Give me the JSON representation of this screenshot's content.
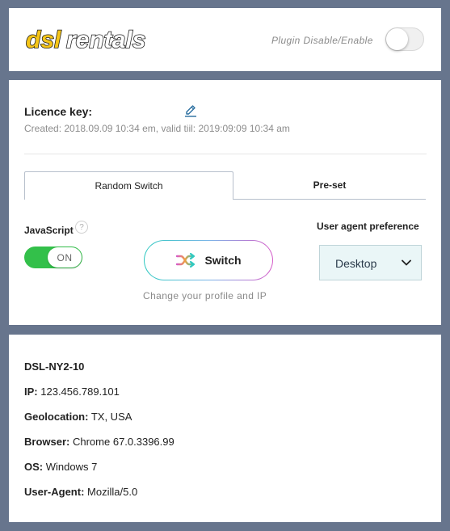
{
  "header": {
    "logo_text": "dslrentals",
    "plugin_label": "Plugin Disable/Enable",
    "plugin_enabled": false
  },
  "licence": {
    "title": "Licence key:",
    "meta": "Created: 2018.09.09 10:34 em, valid tiil: 2019:09:09 10:34 am"
  },
  "tabs": [
    {
      "label": "Random Switch",
      "active": true
    },
    {
      "label": "Pre-set",
      "active": false
    }
  ],
  "javascript": {
    "label": "JavaScript",
    "help": "?",
    "toggle_state": "ON"
  },
  "switch": {
    "label": "Switch",
    "caption": "Change your profile and IP"
  },
  "user_agent": {
    "label": "User agent preference",
    "selected": "Desktop"
  },
  "info": {
    "title": "DSL-NY2-10",
    "rows": [
      {
        "key": "IP:",
        "value": "123.456.789.101"
      },
      {
        "key": "Geolocation:",
        "value": "TX, USA"
      },
      {
        "key": "Browser:",
        "value": "Chrome 67.0.3396.99"
      },
      {
        "key": "OS:",
        "value": "Windows 7"
      },
      {
        "key": "User-Agent:",
        "value": "Mozilla/5.0"
      }
    ]
  },
  "colors": {
    "background": "#67758d",
    "toggle_on": "#33c04a",
    "logo_yellow": "#f5c518",
    "gradient_start": "#2fc9c1",
    "gradient_end": "#d65cc9"
  }
}
